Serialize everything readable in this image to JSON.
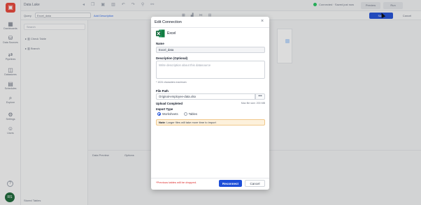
{
  "app": {
    "topbar": {
      "title": "Data Lake",
      "status": "Connected · Saved just now",
      "preview_label": "Preview",
      "run_label": "Run"
    },
    "toolbar": {
      "label": "Query",
      "select_value": "Excel_data",
      "add_label": "Add Description",
      "save_label": "Save",
      "cancel_label": "Cancel"
    },
    "nav": [
      {
        "icon": "dashboard-icon",
        "label": "Dashboards"
      },
      {
        "icon": "data-sources-icon",
        "label": "Data Sources"
      },
      {
        "icon": "pipelines-icon",
        "label": "Pipelines"
      },
      {
        "icon": "datastores-icon",
        "label": "Datastores"
      },
      {
        "icon": "schedules-icon",
        "label": "Schedules"
      },
      {
        "icon": "explore-icon",
        "label": "Explore"
      },
      {
        "icon": "settings-icon",
        "label": "Settings"
      },
      {
        "icon": "users-icon",
        "label": "Users"
      }
    ],
    "avatar_initials": "RS",
    "sidepanel": {
      "search_placeholder": "Search",
      "items": [
        "Check Table",
        "Branch"
      ],
      "bottom_label": "Stored Tables"
    },
    "data_preview": {
      "tab_label": "Data Preview",
      "tab2_label": "Options"
    }
  },
  "modal": {
    "title": "Edit Connection",
    "close_glyph": "×",
    "source_name": "Excel",
    "name_label": "Name",
    "name_value": "Excel_data",
    "description_label": "Description (Optional)",
    "description_placeholder": "Write description about this datasource",
    "char_hint": "* 1024 characters maximum",
    "file_path_label": "File Path",
    "file_path_value": "Original-employee-data.xlsx",
    "file_button_glyph": "•••",
    "upload_status": "Upload Completed",
    "max_size": "Max file size: 200 MB",
    "import_type_label": "Import Type",
    "import_options": [
      "Worksheets",
      "Tables"
    ],
    "import_selected": "Worksheets",
    "note_label": "Note",
    "note_text": ": Larger files will take more time to import",
    "warning": "*Previous tables will be dropped.",
    "reconnect_label": "Reconnect",
    "cancel_label": "Cancel"
  },
  "colors": {
    "primary": "#1d4ed8",
    "excel_green": "#1e7145",
    "warning_red": "#dc2626",
    "note_bg": "#fdf1dc"
  }
}
